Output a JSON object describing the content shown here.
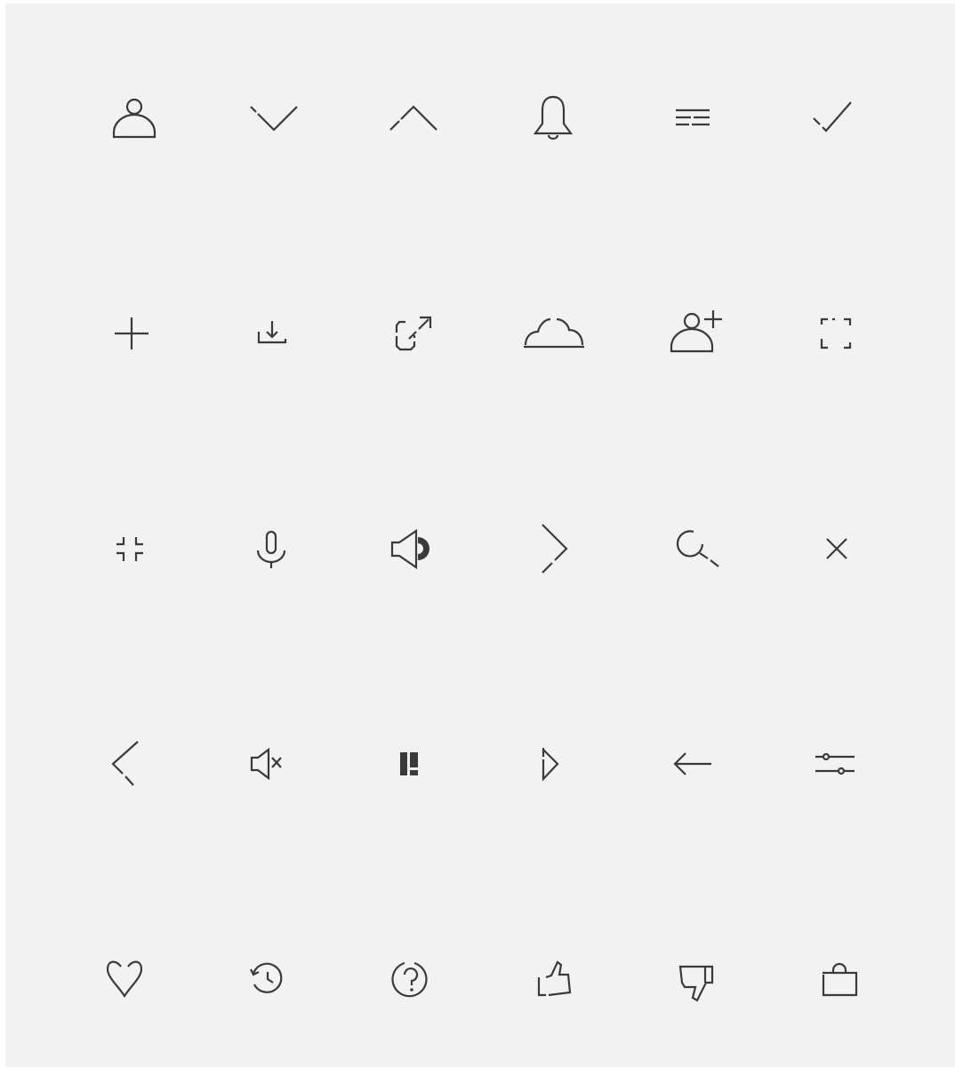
{
  "background_color": "#f2f2f2",
  "icon_color": "#3a3a3a",
  "icons": [
    [
      "user-icon",
      "chevron-down-icon",
      "chevron-up-icon",
      "bell-icon",
      "menu-icon",
      "check-icon"
    ],
    [
      "plus-icon",
      "download-icon",
      "external-link-icon",
      "cloud-icon",
      "add-user-icon",
      "fullscreen-icon"
    ],
    [
      "exit-fullscreen-icon",
      "microphone-icon",
      "volume-on-icon",
      "chevron-right-icon",
      "search-icon",
      "close-icon"
    ],
    [
      "chevron-left-icon",
      "volume-mute-icon",
      "pause-icon",
      "play-icon",
      "arrow-left-icon",
      "sliders-icon"
    ],
    [
      "heart-icon",
      "history-icon",
      "help-icon",
      "thumbs-up-icon",
      "thumbs-down-icon",
      "shopping-bag-icon"
    ]
  ]
}
